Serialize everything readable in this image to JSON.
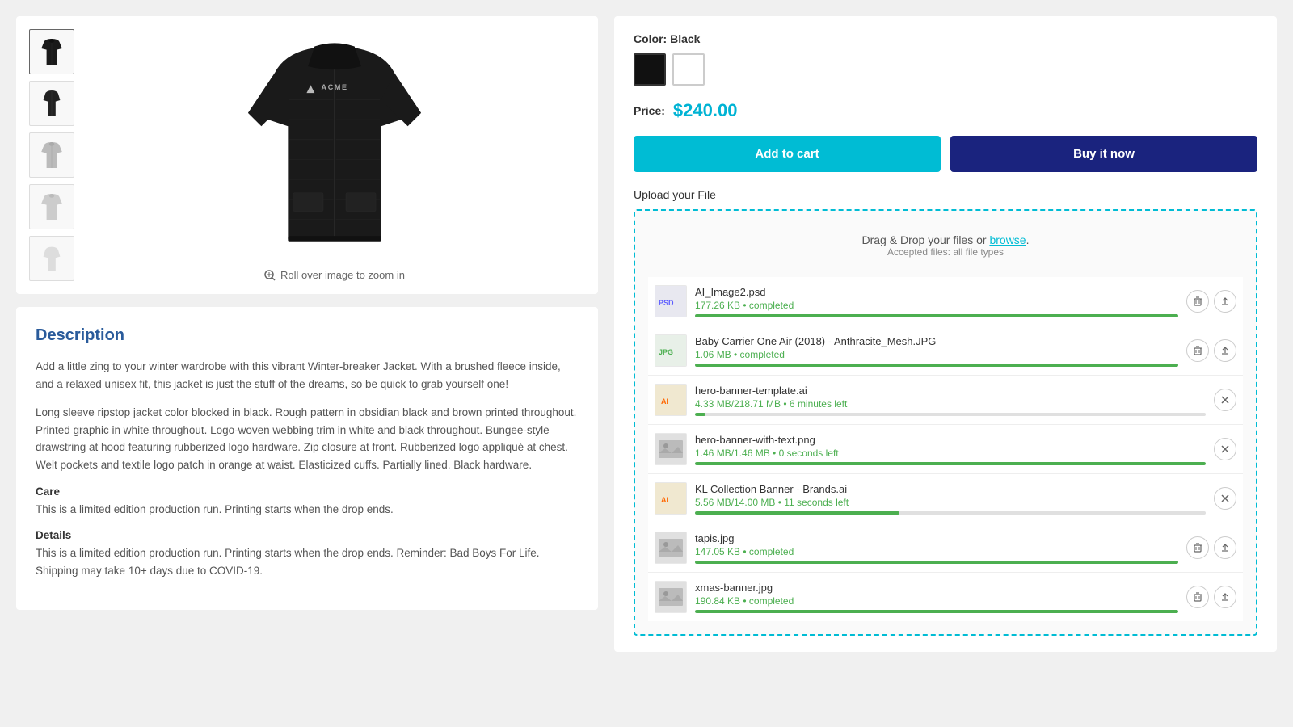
{
  "product": {
    "color_label": "Color:",
    "color_value": "Black",
    "colors": [
      {
        "name": "Black",
        "value": "black",
        "active": true
      },
      {
        "name": "White",
        "value": "white",
        "active": false
      }
    ],
    "price_label": "Price:",
    "price": "$240.00",
    "add_to_cart": "Add to cart",
    "buy_it_now": "Buy it now",
    "upload_label": "Upload your File",
    "drop_zone_text": "Drag & Drop your files or",
    "browse_text": "browse",
    "accepted_files_text": "Accepted files: all file types",
    "zoom_hint": "Roll over image to zoom in"
  },
  "files": [
    {
      "name": "AI_Image2.psd",
      "status": "177.26 KB • completed",
      "status_type": "completed",
      "progress": 100,
      "thumb_type": "psd",
      "actions": [
        "delete",
        "upload"
      ]
    },
    {
      "name": "Baby Carrier One Air (2018) - Anthracite_Mesh.JPG",
      "status": "1.06 MB • completed",
      "status_type": "completed",
      "progress": 100,
      "thumb_type": "jpg",
      "actions": [
        "delete",
        "upload"
      ]
    },
    {
      "name": "hero-banner-template.ai",
      "status": "4.33 MB/218.71 MB • 6 minutes left",
      "status_type": "uploading",
      "progress": 2,
      "thumb_type": "ai",
      "actions": [
        "close"
      ]
    },
    {
      "name": "hero-banner-with-text.png",
      "status": "1.46 MB/1.46 MB • 0 seconds left",
      "status_type": "uploading",
      "progress": 100,
      "thumb_type": "img",
      "actions": [
        "close"
      ]
    },
    {
      "name": "KL Collection Banner - Brands.ai",
      "status": "5.56 MB/14.00 MB • 11 seconds left",
      "status_type": "uploading",
      "progress": 40,
      "thumb_type": "ai",
      "actions": [
        "close"
      ]
    },
    {
      "name": "tapis.jpg",
      "status": "147.05 KB • completed",
      "status_type": "completed",
      "progress": 100,
      "thumb_type": "img",
      "actions": [
        "delete",
        "upload"
      ]
    },
    {
      "name": "xmas-banner.jpg",
      "status": "190.84 KB • completed",
      "status_type": "completed",
      "progress": 100,
      "thumb_type": "img",
      "actions": [
        "delete",
        "upload"
      ]
    }
  ],
  "description": {
    "title": "Description",
    "paragraphs": [
      "Add a little zing to your winter wardrobe with this vibrant Winter-breaker Jacket. With a brushed fleece inside, and a relaxed unisex fit, this jacket is just the stuff of the dreams, so be quick to grab yourself one!",
      "Long sleeve ripstop jacket color blocked in black. Rough pattern in obsidian black and brown printed throughout. Printed graphic in white throughout. Logo-woven webbing trim in white and black throughout. Bungee-style drawstring at hood featuring rubberized logo hardware. Zip closure at front. Rubberized logo appliqué at chest. Welt pockets and textile logo patch in orange at waist. Elasticized cuffs. Partially lined. Black hardware."
    ],
    "care_label": "Care",
    "care_text": "This is a limited edition production run. Printing starts when the drop ends.",
    "details_label": "Details",
    "details_text": "This is a limited edition production run. Printing starts when the drop ends. Reminder: Bad Boys For Life. Shipping may take 10+ days due to COVID-19."
  }
}
